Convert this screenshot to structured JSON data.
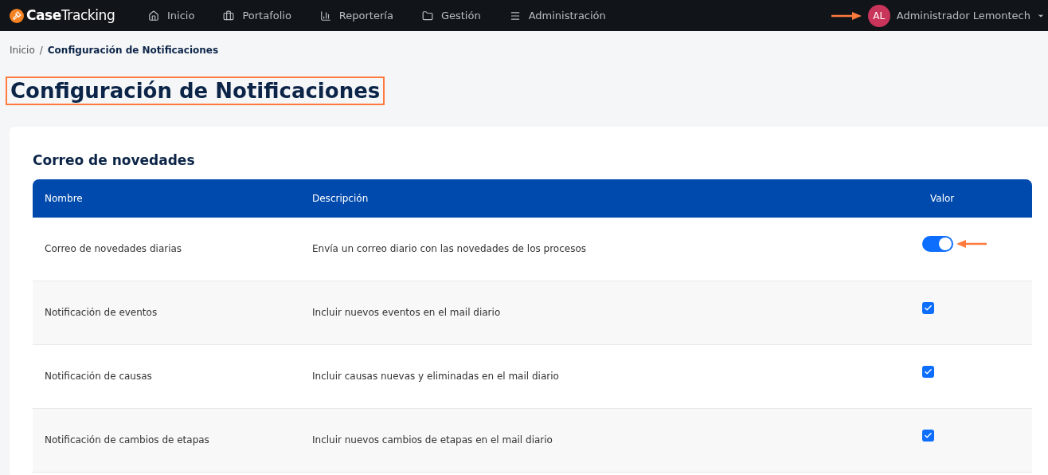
{
  "navbar": {
    "brand_bold": "Case",
    "brand_light": "Tracking",
    "items": [
      {
        "label": "Inicio"
      },
      {
        "label": "Portafolio"
      },
      {
        "label": "Reportería"
      },
      {
        "label": "Gestión"
      },
      {
        "label": "Administración"
      }
    ],
    "user": {
      "initials": "AL",
      "name": "Administrador Lemontech"
    }
  },
  "breadcrumb": {
    "parent": "Inicio",
    "separator": "/",
    "current": "Configuración de Notificaciones"
  },
  "title": "Configuración de Notificaciones",
  "section": {
    "title": "Correo de novedades",
    "columns": [
      "Nombre",
      "Descripción",
      "Valor"
    ],
    "rows": [
      {
        "name": "Correo de novedades diarias",
        "description": "Envía un correo diario con las novedades de los procesos",
        "kind": "switch",
        "on": true
      },
      {
        "name": "Notificación de eventos",
        "description": "Incluir nuevos eventos en el mail diario",
        "kind": "checkbox",
        "checked": true
      },
      {
        "name": "Notificación de causas",
        "description": "Incluir causas nuevas y eliminadas en el mail diario",
        "kind": "checkbox",
        "checked": true
      },
      {
        "name": "Notificación de cambios de etapas",
        "description": "Incluir nuevos cambios de etapas en el mail diario",
        "kind": "checkbox",
        "checked": true
      }
    ]
  }
}
